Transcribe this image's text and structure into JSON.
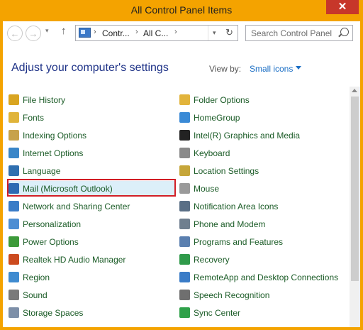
{
  "window": {
    "title": "All Control Panel Items",
    "close_glyph": "✕"
  },
  "nav": {
    "back_glyph": "←",
    "forward_glyph": "→",
    "dropdown_glyph": "▾",
    "up_glyph": "↑",
    "breadcrumb": [
      "Contr...",
      "All C..."
    ],
    "breadcrumb_sep": "›",
    "refresh_glyph": "↻",
    "search_placeholder": "Search Control Panel"
  },
  "header": {
    "title": "Adjust your computer's settings",
    "view_by_label": "View by:",
    "view_by_value": "Small icons"
  },
  "left_items": [
    {
      "label": "File History",
      "icon": "file-history-icon",
      "color": "#d9a521"
    },
    {
      "label": "Fonts",
      "icon": "fonts-icon",
      "color": "#e0b43a"
    },
    {
      "label": "Indexing Options",
      "icon": "indexing-options-icon",
      "color": "#c7a24a"
    },
    {
      "label": "Internet Options",
      "icon": "internet-options-icon",
      "color": "#3a86c8"
    },
    {
      "label": "Language",
      "icon": "language-icon",
      "color": "#2f6fb0"
    },
    {
      "label": "Mail (Microsoft Outlook)",
      "icon": "mail-icon",
      "color": "#2d6ab3"
    },
    {
      "label": "Network and Sharing Center",
      "icon": "network-icon",
      "color": "#3a7cc7"
    },
    {
      "label": "Personalization",
      "icon": "personalization-icon",
      "color": "#4d8ed3"
    },
    {
      "label": "Power Options",
      "icon": "power-options-icon",
      "color": "#3d9a3a"
    },
    {
      "label": "Realtek HD Audio Manager",
      "icon": "realtek-audio-icon",
      "color": "#cc4b1f"
    },
    {
      "label": "Region",
      "icon": "region-icon",
      "color": "#3f8bd0"
    },
    {
      "label": "Sound",
      "icon": "sound-icon",
      "color": "#7a7a7a"
    },
    {
      "label": "Storage Spaces",
      "icon": "storage-spaces-icon",
      "color": "#7d8fa8"
    }
  ],
  "right_items": [
    {
      "label": "Folder Options",
      "icon": "folder-options-icon",
      "color": "#e2b43c"
    },
    {
      "label": "HomeGroup",
      "icon": "homegroup-icon",
      "color": "#3a8ad6"
    },
    {
      "label": "Intel(R) Graphics and Media",
      "icon": "intel-graphics-icon",
      "color": "#222222"
    },
    {
      "label": "Keyboard",
      "icon": "keyboard-icon",
      "color": "#8a8a8a"
    },
    {
      "label": "Location Settings",
      "icon": "location-settings-icon",
      "color": "#c6a63a"
    },
    {
      "label": "Mouse",
      "icon": "mouse-icon",
      "color": "#9a9a9a"
    },
    {
      "label": "Notification Area Icons",
      "icon": "notification-area-icon",
      "color": "#5a6f86"
    },
    {
      "label": "Phone and Modem",
      "icon": "phone-modem-icon",
      "color": "#6f7f8f"
    },
    {
      "label": "Programs and Features",
      "icon": "programs-features-icon",
      "color": "#5a7faf"
    },
    {
      "label": "Recovery",
      "icon": "recovery-icon",
      "color": "#2f9a4a"
    },
    {
      "label": "RemoteApp and Desktop Connections",
      "icon": "remoteapp-icon",
      "color": "#3a7cc7"
    },
    {
      "label": "Speech Recognition",
      "icon": "speech-recognition-icon",
      "color": "#6f6f6f"
    },
    {
      "label": "Sync Center",
      "icon": "sync-center-icon",
      "color": "#2fa14a"
    }
  ],
  "colors": {
    "accent": "#f4a300",
    "link_green": "#1a5b26",
    "heading_blue": "#1e3287",
    "highlight_red": "#d21e26",
    "selection": "#dceff9"
  }
}
